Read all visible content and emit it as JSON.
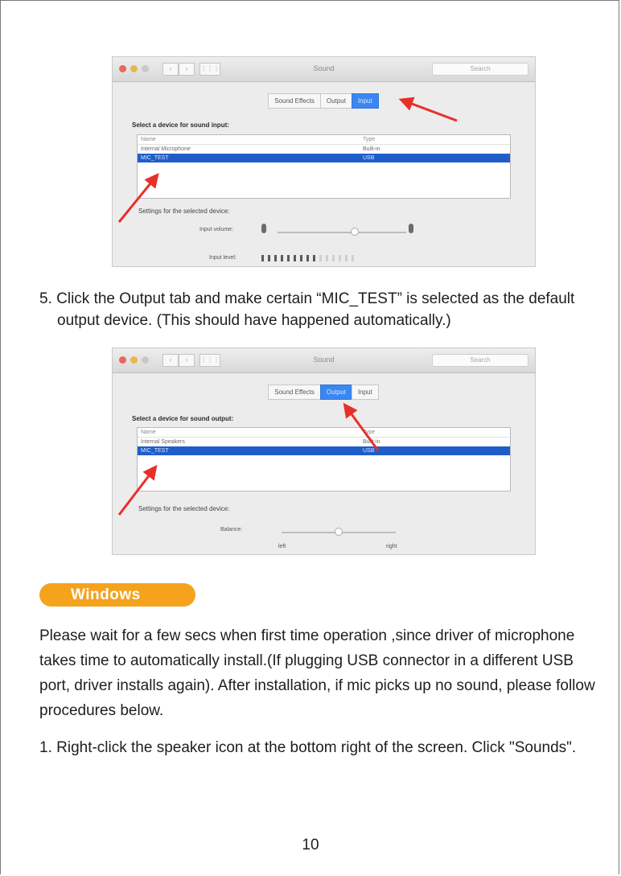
{
  "screenshot1": {
    "window_title": "Sound",
    "search_placeholder": "Search",
    "tabs": [
      "Sound Effects",
      "Output",
      "Input"
    ],
    "selected_tab": "Input",
    "section_label": "Select a device for sound input:",
    "columns": [
      "Name",
      "Type"
    ],
    "rows": [
      {
        "name": "Internal Microphone",
        "type": "Built-in"
      },
      {
        "name": "MIC_TEST",
        "type": "USB"
      }
    ],
    "settings_label": "Settings for the selected device:",
    "input_volume_label": "Input volume:",
    "input_level_label": "Input level:",
    "input_volume_level": 0.6,
    "input_level_lit_bars": 9,
    "input_level_total_bars": 15
  },
  "step5": {
    "text": "5. Click the Output tab and make certain “MIC_TEST” is selected as the default output device. (This should have happened automatically.)"
  },
  "screenshot2": {
    "window_title": "Sound",
    "search_placeholder": "Search",
    "tabs": [
      "Sound Effects",
      "Output",
      "Input"
    ],
    "selected_tab": "Output",
    "section_label": "Select a device for sound output:",
    "columns": [
      "Name",
      "Type"
    ],
    "rows": [
      {
        "name": "Internal Speakers",
        "type": "Built-in"
      },
      {
        "name": "MIC_TEST",
        "type": "USB"
      }
    ],
    "settings_label": "Settings for the selected device:",
    "balance_label": "Balance:",
    "balance_left": "left",
    "balance_right": "right",
    "balance_level": 0.5
  },
  "windows_heading": "Windows",
  "windows_paragraph": "Please wait for a few secs when first time operation ,since driver of microphone takes time to automatically install.(If plugging USB connector in a different USB port, driver installs again). After installation, if mic picks up no sound, please follow procedures below.",
  "step1": {
    "text": "1. Right-click the speaker icon at the bottom right of the screen. Click \"Sounds\"."
  },
  "page_number": "10",
  "colors": {
    "pill": "#f5a21d",
    "selection_blue": "#1f5ec9",
    "arrow_red": "#e8302a"
  }
}
